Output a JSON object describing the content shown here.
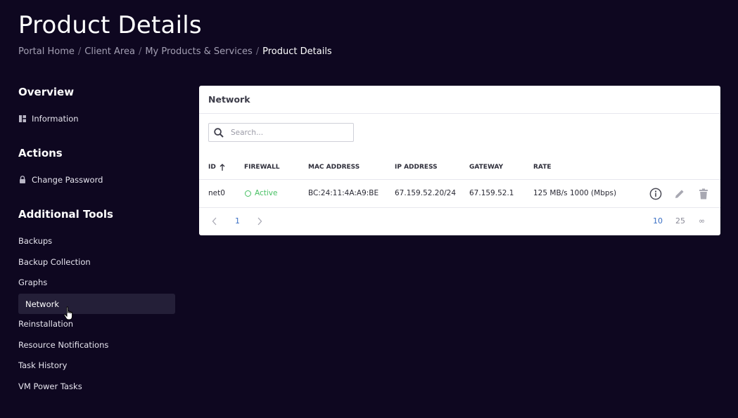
{
  "page": {
    "title": "Product Details"
  },
  "breadcrumb": {
    "items": [
      "Portal Home",
      "Client Area",
      "My Products & Services"
    ],
    "current": "Product Details",
    "separator": "/"
  },
  "sidebar": {
    "overview": {
      "heading": "Overview",
      "items": [
        {
          "label": "Information",
          "icon": "dashboard-icon"
        }
      ]
    },
    "actions": {
      "heading": "Actions",
      "items": [
        {
          "label": "Change Password",
          "icon": "lock-icon"
        }
      ]
    },
    "tools": {
      "heading": "Additional Tools",
      "items": [
        {
          "label": "Backups"
        },
        {
          "label": "Backup Collection"
        },
        {
          "label": "Graphs"
        },
        {
          "label": "Network",
          "active": true
        },
        {
          "label": "Reinstallation"
        },
        {
          "label": "Resource Notifications"
        },
        {
          "label": "Task History"
        },
        {
          "label": "VM Power Tasks"
        }
      ]
    }
  },
  "network_panel": {
    "title": "Network",
    "search": {
      "placeholder": "Search..."
    },
    "columns": [
      "ID",
      "FIREWALL",
      "MAC ADDRESS",
      "IP ADDRESS",
      "GATEWAY",
      "RATE"
    ],
    "sort": {
      "column": "ID",
      "direction": "ascending",
      "icon": "arrow-up-icon"
    },
    "rows": [
      {
        "id": "net0",
        "firewall": "Active",
        "mac": "BC:24:11:4A:A9:BE",
        "ip": "67.159.52.20/24",
        "gateway": "67.159.52.1",
        "rate": "125 MB/s 1000 (Mbps)"
      }
    ],
    "row_actions": [
      "info-icon",
      "edit-icon",
      "delete-icon"
    ],
    "pagination": {
      "current_page": "1",
      "page_sizes": [
        "10",
        "25",
        "∞"
      ],
      "selected_size": "10"
    }
  },
  "colors": {
    "background": "#0e0720",
    "active_status": "#47c063",
    "pagination_active": "#3a6fc4",
    "sidebar_active": "#241f38"
  }
}
